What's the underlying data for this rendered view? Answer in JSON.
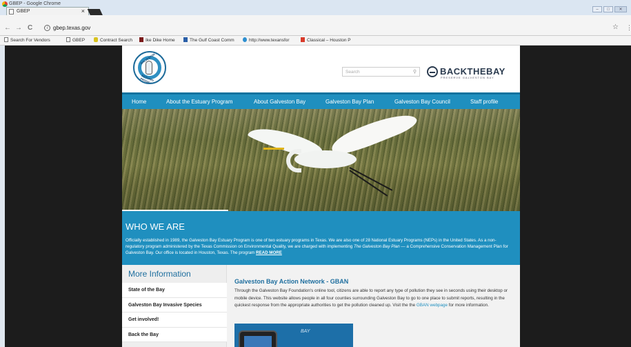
{
  "window": {
    "title": "GBEP - Google Chrome",
    "tab_label": "GBEP",
    "tab_close": "×",
    "controls": [
      "–",
      "□",
      "✕"
    ]
  },
  "toolbar": {
    "back": "←",
    "forward": "→",
    "reload": "C",
    "info": "i",
    "url": "gbep.texas.gov",
    "star": "☆",
    "menu": "⋮"
  },
  "bookmarks": [
    {
      "label": "Search For Vendors"
    },
    {
      "label": "GBEP"
    },
    {
      "label": "Contract Search"
    },
    {
      "label": "Ike Dike Home"
    },
    {
      "label": "The Gulf Coast Comm"
    },
    {
      "label": "http://www.texansfor"
    },
    {
      "label": "Classical – Houston P"
    }
  ],
  "site": {
    "logo": {
      "top": "GALVESTON BAY",
      "bottom": "ESTUARY PROGRAM"
    },
    "search": {
      "placeholder": "Search",
      "icon": "⚲"
    },
    "back_the_bay": {
      "title": "BACKTHEBAY",
      "subtitle": "PRESERVE GALVESTON BAY"
    },
    "nav": [
      "Home",
      "About the Estuary Program",
      "About Galveston Bay",
      "Galveston Bay Plan",
      "Galveston Bay Council",
      "Staff profile"
    ],
    "who": {
      "title": "WHO WE ARE",
      "text_1": "Officially established in 1989, the Galveston Bay Estuary Program is one of two estuary programs in Texas.  We are also one of 28 National Estuary Programs (NEPs) in the United States. As a non-regulatory program administered by the Texas Commission on Environmental Quality, we are charged with implementing ",
      "text_em": "The Galveston Bay Plan",
      "text_2": " — a Comprehensive Conservation Management Plan for Galveston Bay.  Our office is located in Houston, Texas.  The program ",
      "read_more": "READ MORE"
    },
    "more_info": {
      "title": "More Information",
      "items": [
        "State of the Bay",
        "Galveston Bay Invasive Species",
        "Get involved!",
        "Back the Bay"
      ]
    },
    "article": {
      "title": "Galveston Bay Action Network - GBAN",
      "text_1": "Through the Galveston Bay Foundation's online tool, citizens are able to report any type of pollution they see in seconds using their desktop or mobile device. This website allows people in all four counties surrounding Galveston Bay to go to one place to submit reports, resulting in the quickest response from the appropriate authorities to get the pollution cleaned up. Visit the the ",
      "link": "GBAN webpage",
      "text_2": " for more information.",
      "image_logo": "BAY"
    }
  }
}
